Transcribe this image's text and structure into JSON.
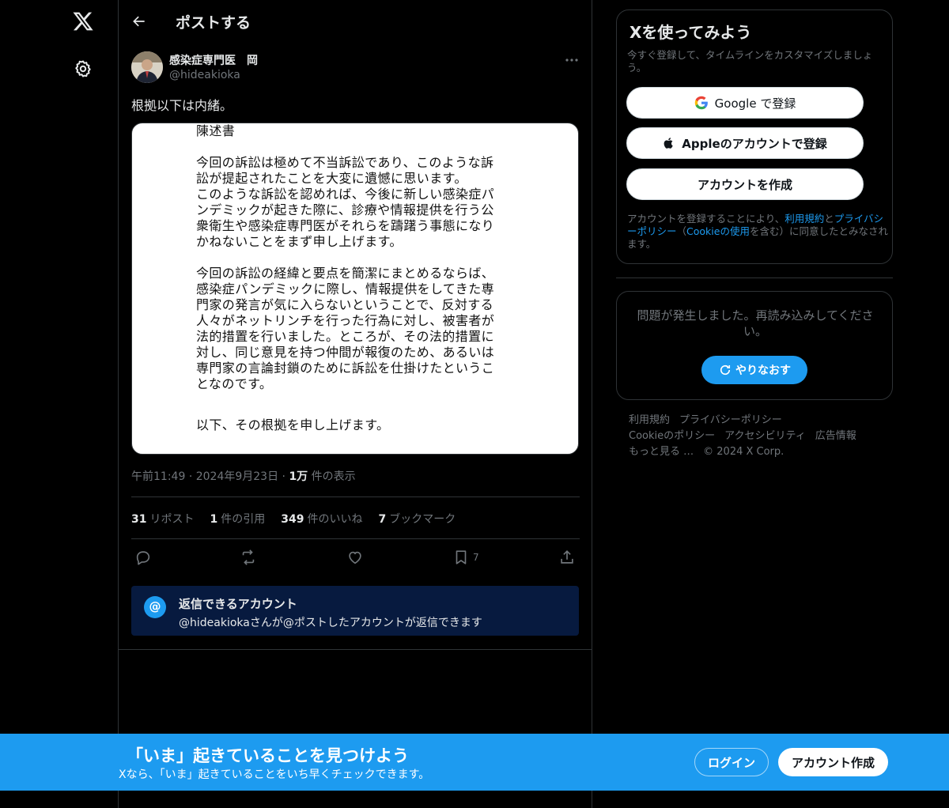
{
  "nav": {
    "logo_icon": "x-logo-icon",
    "settings_icon": "gear-icon"
  },
  "header": {
    "title": "ポストする"
  },
  "post": {
    "author_name": "感染症専門医　岡",
    "author_handle": "@hideakioka",
    "text": "根拠以下は内緒。",
    "image_text": {
      "heading": "陳述書",
      "para1": [
        "今回の訴訟は極めて不当訴訟であり、このような訴",
        "訟が提起されたことを大変に遺憾に思います。",
        "このような訴訟を認めれば、今後に新しい感染症パ",
        "ンデミックが起きた際に、診療や情報提供を行う公",
        "衆衛生や感染症専門医がそれらを躊躇う事態になり",
        "かねないことをまず申し上げます。"
      ],
      "para2": [
        "今回の訴訟の経緯と要点を簡潔にまとめるならば、",
        "感染症パンデミックに際し、情報提供をしてきた専",
        "門家の発言が気に入らないということで、反対する",
        "人々がネットリンチを行った行為に対し、被害者が",
        "法的措置を行いました。ところが、その法的措置に",
        "対し、同じ意見を持つ仲間が報復のため、あるいは",
        "専門家の言論封鎖のために訴訟を仕掛けたというこ",
        "となのです。"
      ],
      "para3": "以下、その根拠を申し上げます。"
    },
    "time": "午前11:49",
    "date": "2024年9月23日",
    "views_count": "1万",
    "views_label": "件の表示",
    "stats": {
      "reposts": "31",
      "reposts_label": "リポスト",
      "quotes": "1",
      "quotes_label": "件の引用",
      "likes": "349",
      "likes_label": "件のいいね",
      "bookmarks": "7",
      "bookmarks_label": "ブックマーク"
    },
    "bookmark_action_count": "7",
    "reply_restriction": {
      "title": "返信できるアカウント",
      "subtitle": "@hideakiokaさんが@ポストしたアカウントが返信できます",
      "badge": "@"
    }
  },
  "signup": {
    "title": "Xを使ってみよう",
    "subtitle": "今すぐ登録して、タイムラインをカスタマイズしましょう。",
    "google_label": "Google で登録",
    "apple_label": "Appleのアカウントで登録",
    "create_label": "アカウントを作成",
    "terms_pre": "アカウントを登録することにより、",
    "terms_link1": "利用規約",
    "terms_and": "と",
    "terms_link2": "プライバシーポリシー",
    "terms_mid": "（",
    "terms_link3": "Cookieの使用",
    "terms_post": "を含む）に同意したとみなされます。"
  },
  "error_card": {
    "message": "問題が発生しました。再読み込みしてください。",
    "retry_label": "やりなおす"
  },
  "footer": {
    "links": [
      "利用規約",
      "プライバシーポリシー",
      "Cookieのポリシー",
      "アクセシビリティ",
      "広告情報",
      "もっと見る …"
    ],
    "copyright": "© 2024 X Corp."
  },
  "banner": {
    "title": "「いま」起きていることを見つけよう",
    "subtitle": "Xなら、「いま」起きていることをいち早くチェックできます。",
    "login_label": "ログイン",
    "create_label": "アカウント作成"
  },
  "colors": {
    "accent": "#1d9bf0",
    "background": "#000000",
    "border": "#2f3336",
    "muted": "#71767b",
    "reply_box": "#071a3f"
  }
}
